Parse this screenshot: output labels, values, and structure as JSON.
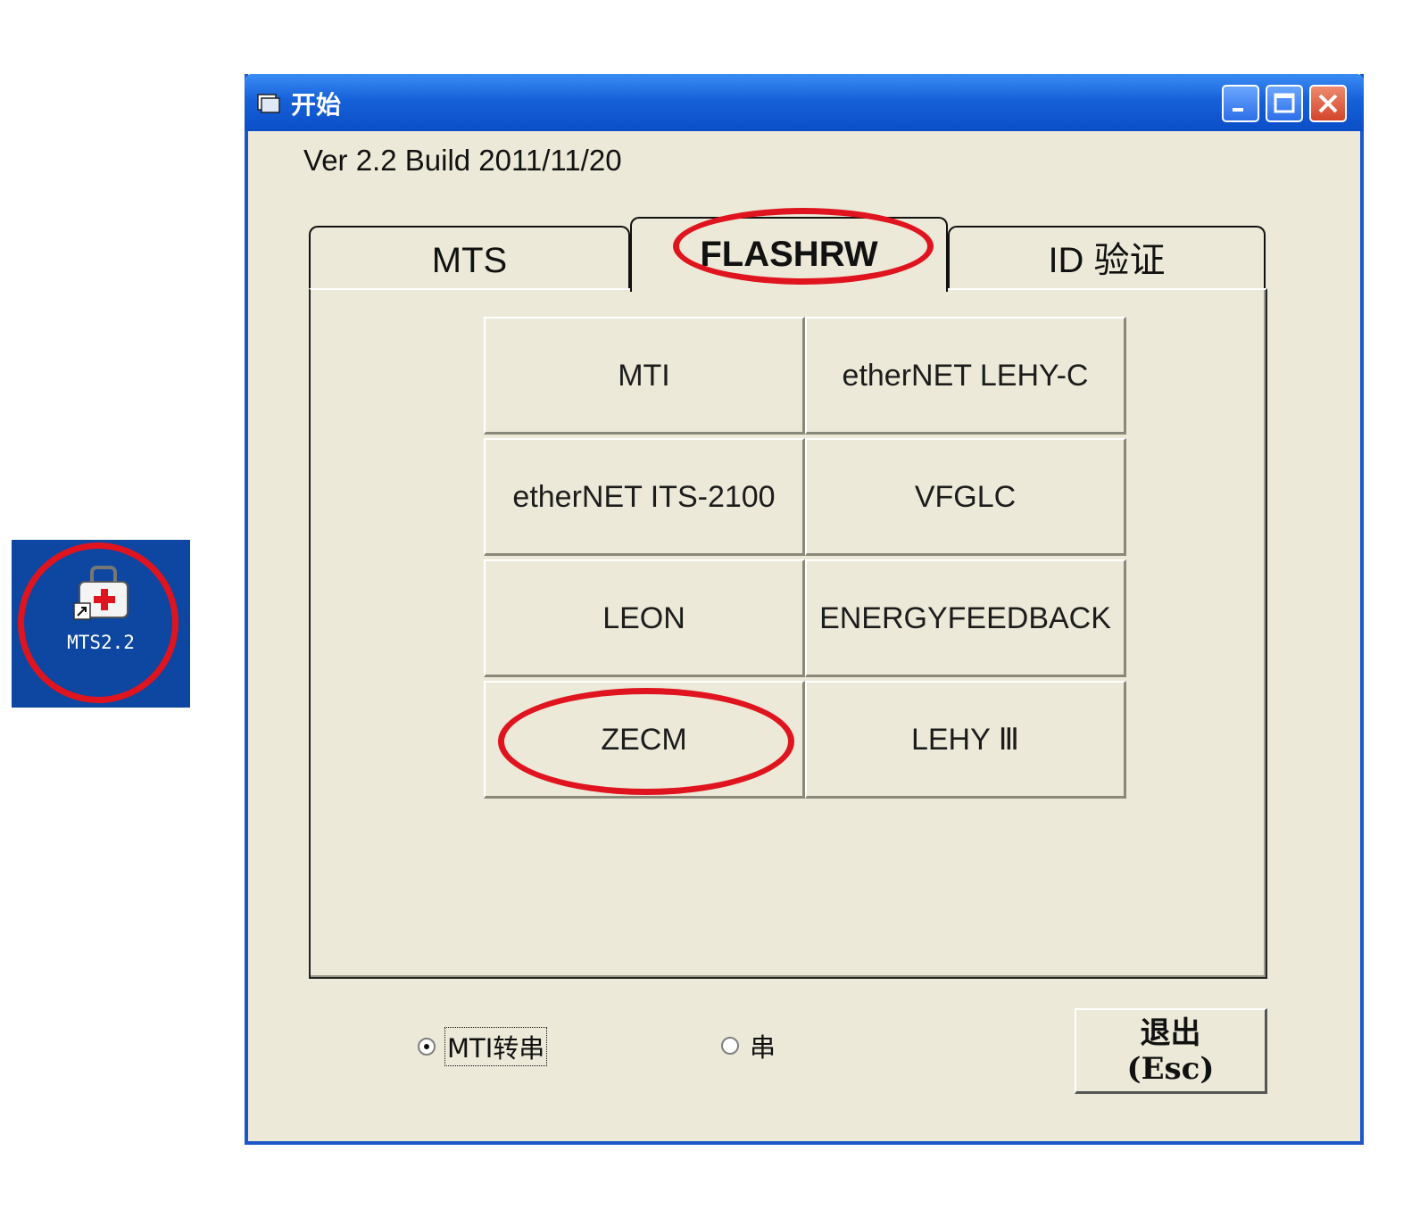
{
  "desktop": {
    "shortcut_label": "MTS2.2",
    "icon": "medical-kit-shortcut-icon"
  },
  "window": {
    "title": "开始",
    "title_icon": "app-icon",
    "controls": [
      "minimize-icon",
      "maximize-icon",
      "close-icon"
    ]
  },
  "version_text": "Ver 2.2 Build 2011/11/20",
  "tabs": [
    {
      "label": "MTS"
    },
    {
      "label": "FLASHRW",
      "selected": true
    },
    {
      "label": "ID 验证"
    }
  ],
  "buttons": [
    {
      "label": "MTI"
    },
    {
      "label": "etherNET LEHY-C"
    },
    {
      "label": "etherNET ITS-2100"
    },
    {
      "label": "VFGLC"
    },
    {
      "label": "LEON"
    },
    {
      "label": "ENERGYFEEDBACK"
    },
    {
      "label": "ZECM"
    },
    {
      "label": "LEHY Ⅲ"
    }
  ],
  "radios": [
    {
      "label": "MTI转串",
      "checked": true
    },
    {
      "label": "串",
      "checked": false
    }
  ],
  "exit_button": {
    "line1": "退出",
    "line2": "(Esc)"
  },
  "colors": {
    "titlebar": "#1661d8",
    "window_bg": "#ece9d8",
    "highlight_ring": "#e0141e",
    "desktop_icon_bg": "#0d47a1"
  }
}
